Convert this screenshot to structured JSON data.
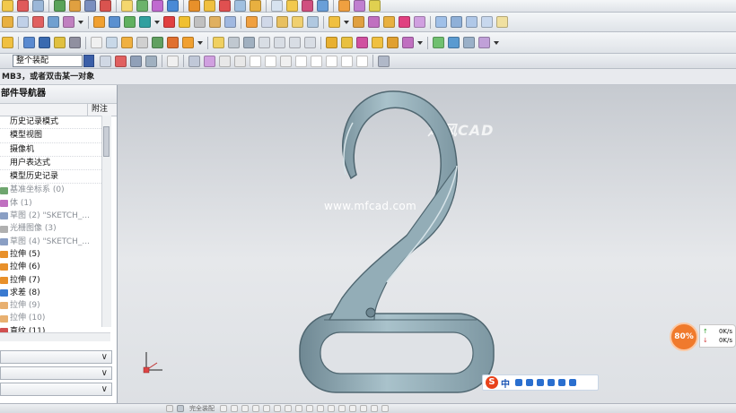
{
  "toolbar": {
    "filter_value": "整个装配"
  },
  "cue_line": "MB3，或者双击某一对象",
  "navigator": {
    "title": "部件导航器",
    "column_note": "附注",
    "items": [
      {
        "label": "历史记录模式",
        "dim": false,
        "icon_color": "#ffffff"
      },
      {
        "label": "模型视图",
        "dim": false,
        "icon_color": "#ffffff"
      },
      {
        "label": "摄像机",
        "dim": false,
        "icon_color": "#ffffff"
      },
      {
        "label": "用户表达式",
        "dim": false,
        "icon_color": "#ffffff"
      },
      {
        "label": "模型历史记录",
        "dim": false,
        "icon_color": "#ffffff"
      },
      {
        "label": "基准坐标系 (0)",
        "dim": true,
        "icon_color": "#6fa66f"
      },
      {
        "label": "体 (1)",
        "dim": true,
        "icon_color": "#c070c0"
      },
      {
        "label": "草图 (2) \"SKETCH_...",
        "dim": true,
        "icon_color": "#8a9fc4"
      },
      {
        "label": "光栅图像 (3)",
        "dim": true,
        "icon_color": "#b0b0b0"
      },
      {
        "label": "草图 (4) \"SKETCH_...",
        "dim": true,
        "icon_color": "#8a9fc4"
      },
      {
        "label": "拉伸 (5)",
        "dim": false,
        "icon_color": "#e8902a"
      },
      {
        "label": "拉伸 (6)",
        "dim": false,
        "icon_color": "#e8902a"
      },
      {
        "label": "拉伸 (7)",
        "dim": false,
        "icon_color": "#e8902a"
      },
      {
        "label": "求差 (8)",
        "dim": false,
        "icon_color": "#3a7ad0"
      },
      {
        "label": "拉伸 (9)",
        "dim": true,
        "icon_color": "#e8b070"
      },
      {
        "label": "拉伸 (10)",
        "dim": true,
        "icon_color": "#e8b070"
      },
      {
        "label": "直纹 (11)",
        "dim": false,
        "icon_color": "#d05050"
      }
    ]
  },
  "viewport": {
    "watermark": "www.mfcad.com",
    "brand": "沐风CAD",
    "model_color": "#8fa9b3"
  },
  "speed_widget": {
    "percent": "80%",
    "upload": "0K/s",
    "download": "0K/s"
  },
  "ime": {
    "logo": "S",
    "mode": "中"
  },
  "statusbar": {
    "snap_label": "完全装配"
  }
}
